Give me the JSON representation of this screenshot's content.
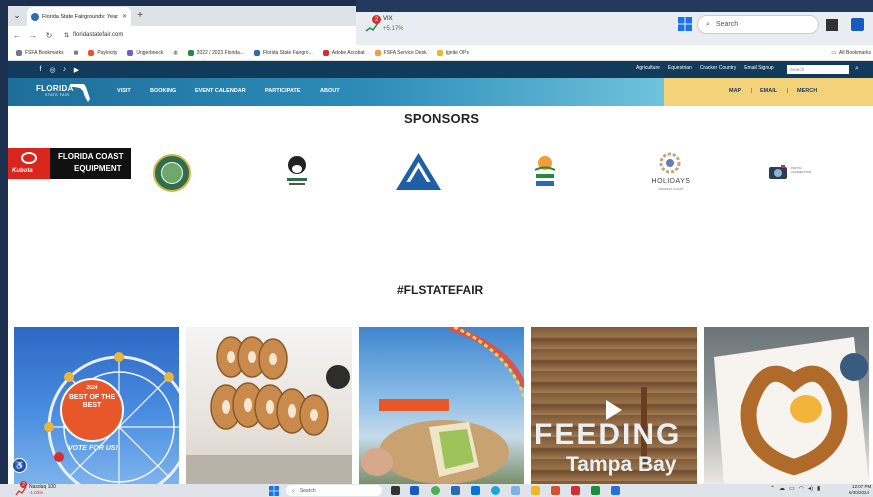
{
  "browser": {
    "tab_title": "Florida State Fairgrounds: Year R",
    "url": "floridastatefair.com",
    "bookmarks": [
      "FSFA Bookmarks",
      "Paylocity",
      "Ungerboeck",
      "2022 / 2023 Florida...",
      "Florida State Fairgro...",
      "Adobe Acrobat",
      "FSFA Service Desk",
      "Ignite OPs"
    ],
    "all_bookmarks": "All Bookmarks"
  },
  "widget": {
    "badge": "2",
    "ticker": "VIX",
    "change": "+5.17%"
  },
  "windows_search": "Search",
  "site": {
    "toplinks": [
      "Agriculture",
      "Equestrian",
      "Cracker Country",
      "Email Signup"
    ],
    "search_placeholder": "Search",
    "logo_main": "FLORIDA",
    "logo_sub": "STATE FAIR",
    "nav": [
      "VISIT",
      "BOOKING",
      "EVENT CALENDAR",
      "PARTICIPATE",
      "ABOUT"
    ],
    "nav_right": [
      "MAP",
      "EMAIL",
      "MERCH"
    ],
    "nav_sep": "|",
    "sponsors_title": "SPONSORS",
    "sponsors": {
      "fce_brand": "Kubota",
      "fce_line1": "FLORIDA COAST",
      "fce_line2": "EQUIPMENT",
      "holidays": "HOLIDAYS",
      "holidays_sub": "MIDWEST COAST",
      "camera_text": "PHOTO CONNECTION"
    },
    "hashtag": "#FLSTATEFAIR",
    "tiles": {
      "badge_year": "2024",
      "badge_text": "BEST OF THE BEST",
      "vote": "VOTE FOR US!",
      "feeding": "FEEDING",
      "tampa": "Tampa Bay"
    }
  },
  "taskbar": {
    "badge": "2",
    "index": "Nasdaq 100",
    "index_change": "-1.03%",
    "search": "Search",
    "time": "12:07 PM",
    "date": "6/30/2024"
  },
  "colors": {
    "site_topbar": "#123a5a",
    "nav_gold": "#f3d27a",
    "desktop": "#1d2f4f"
  }
}
